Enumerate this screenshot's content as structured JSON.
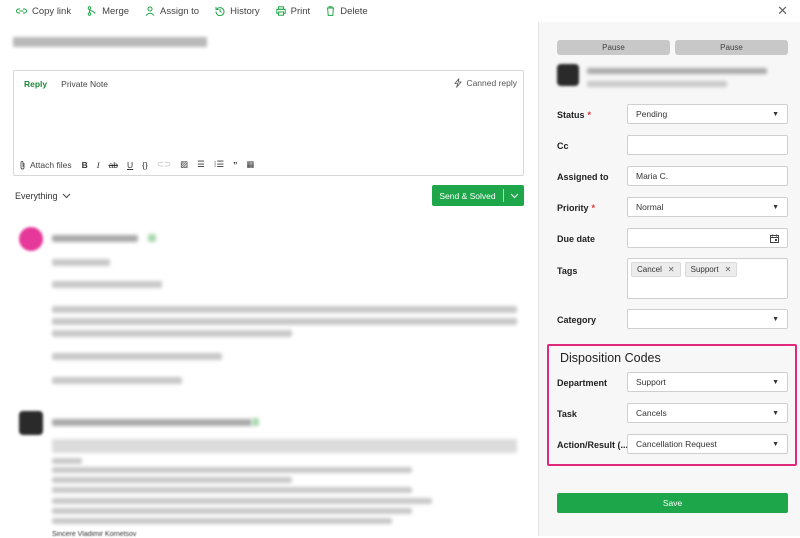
{
  "toolbar": {
    "copy_link": "Copy link",
    "merge": "Merge",
    "assign_to": "Assign to",
    "history": "History",
    "print": "Print",
    "delete": "Delete"
  },
  "editor": {
    "tab_reply": "Reply",
    "tab_note": "Private Note",
    "canned_reply": "Canned reply",
    "attach_files": "Attach files"
  },
  "filter": {
    "label": "Everything"
  },
  "send_button": {
    "label": "Send & Solved"
  },
  "sidebar": {
    "pause_left": "Pause",
    "pause_right": "Pause",
    "fields": {
      "status": {
        "label": "Status",
        "value": "Pending"
      },
      "cc": {
        "label": "Cc",
        "value": ""
      },
      "assigned_to": {
        "label": "Assigned to",
        "value": "Maria C."
      },
      "priority": {
        "label": "Priority",
        "value": "Normal"
      },
      "due_date": {
        "label": "Due date",
        "value": ""
      },
      "tags": {
        "label": "Tags",
        "items": [
          "Cancel",
          "Support"
        ]
      },
      "category": {
        "label": "Category",
        "value": ""
      }
    },
    "disposition": {
      "title": "Disposition Codes",
      "department": {
        "label": "Department",
        "value": "Support"
      },
      "task": {
        "label": "Task",
        "value": "Cancels"
      },
      "action_result": {
        "label": "Action/Result (...",
        "value": "Cancellation Request"
      }
    },
    "save_label": "Save"
  },
  "message2": {
    "signature": "Sincere Vladimir Kornetsov"
  },
  "colors": {
    "accent_green": "#1ea64a",
    "highlight_pink": "#e0297a",
    "required_red": "#d33333"
  }
}
